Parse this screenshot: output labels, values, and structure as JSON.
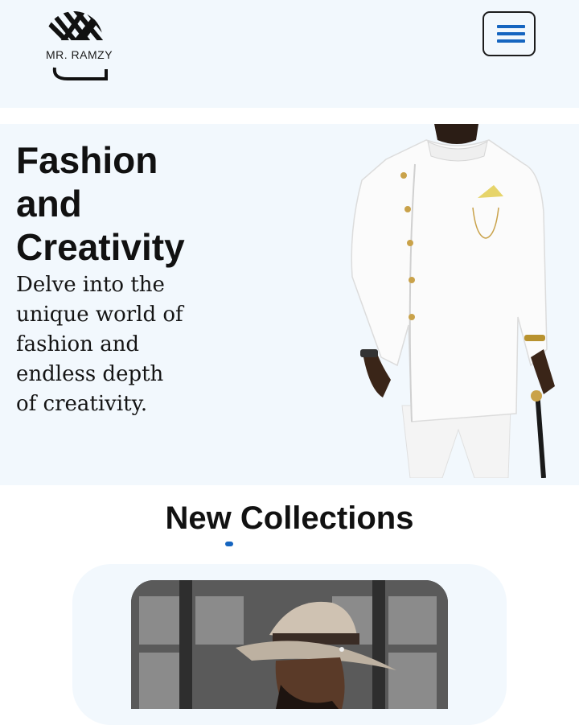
{
  "header": {
    "brand": "MR. RAMZY",
    "menu_icon": "hamburger-menu-icon"
  },
  "hero": {
    "title_lines": [
      "Fashion",
      "and",
      "Creativity"
    ],
    "subtitle": "Delve into the unique world of fashion and endless depth of creativity."
  },
  "collections": {
    "title": "New Collections",
    "active_slide": 1
  },
  "colors": {
    "accent": "#1565c0",
    "panel": "#f2f8fd",
    "text": "#111111"
  }
}
